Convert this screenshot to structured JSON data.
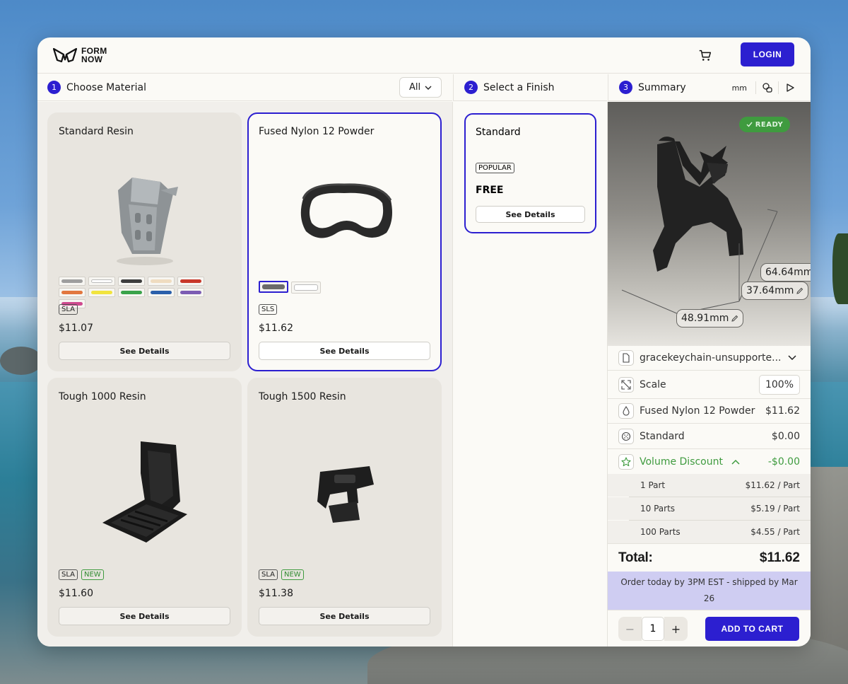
{
  "brand": {
    "line1": "FORM",
    "line2": "NOW"
  },
  "header": {
    "login_label": "LOGIN"
  },
  "steps": {
    "material": {
      "num": "1",
      "title": "Choose Material",
      "filter": "All"
    },
    "finish": {
      "num": "2",
      "title": "Select a Finish"
    },
    "summary": {
      "num": "3",
      "title": "Summary",
      "unit": "mm"
    }
  },
  "materials": [
    {
      "name": "Standard Resin",
      "tags": [
        "SLA"
      ],
      "price": "$11.07",
      "details": "See Details",
      "colors": [
        "#9e9e9e",
        "#ffffff",
        "#3d3d3d",
        "#efdcc0",
        "#c8382a",
        "#e2773f",
        "#f1e43e",
        "#3aa34a",
        "#2a5faa",
        "#7c5cb3",
        "#cf4a8f"
      ]
    },
    {
      "name": "Fused Nylon 12 Powder",
      "tags": [
        "SLS"
      ],
      "price": "$11.62",
      "details": "See Details",
      "colors": [
        "#6b6b6b",
        "#ffffff"
      ]
    },
    {
      "name": "Tough 1000 Resin",
      "tags": [
        "SLA",
        "NEW"
      ],
      "price": "$11.60",
      "details": "See Details"
    },
    {
      "name": "Tough 1500 Resin",
      "tags": [
        "SLA",
        "NEW"
      ],
      "price": "$11.38",
      "details": "See Details"
    }
  ],
  "finish": {
    "name": "Standard",
    "tag": "POPULAR",
    "price": "FREE",
    "details": "See Details"
  },
  "viewer": {
    "status": "READY",
    "dim_x": "48.91mm",
    "dim_y": "37.64mm",
    "dim_z": "64.64mm"
  },
  "summary": {
    "file_name": "gracekeychain-unsupporte...",
    "scale_label": "Scale",
    "scale_value": "100%",
    "material_label": "Fused Nylon 12 Powder",
    "material_price": "$11.62",
    "finish_label": "Standard",
    "finish_price": "$0.00",
    "discount_label": "Volume Discount",
    "discount_value": "-$0.00",
    "tiers": [
      {
        "qty": "1 Part",
        "price": "$11.62 / Part"
      },
      {
        "qty": "10 Parts",
        "price": "$5.19 / Part"
      },
      {
        "qty": "100 Parts",
        "price": "$4.55 / Part"
      }
    ],
    "total_label": "Total:",
    "total_value": "$11.62",
    "shipping": "Order today by 3PM EST - shipped by Mar 26",
    "quantity": "1",
    "minus": "−",
    "plus": "+",
    "add_to_cart": "ADD TO CART"
  },
  "colors": {
    "accent": "#2c1fd0",
    "success": "#3f9b3f"
  }
}
